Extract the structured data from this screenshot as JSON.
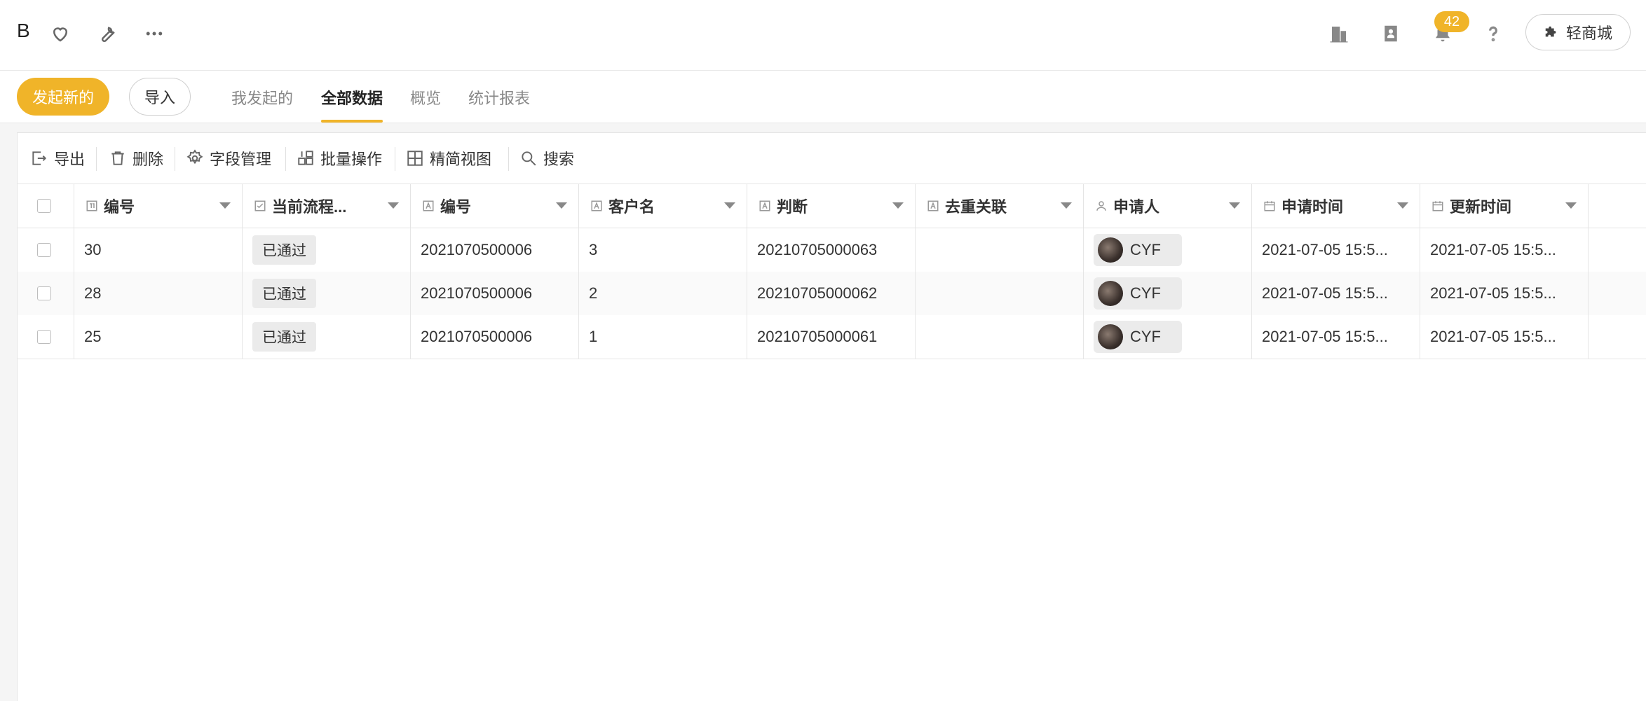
{
  "header": {
    "app_title": "B",
    "notification_count": "42",
    "mall_label": "轻商城",
    "icons": [
      "heart-icon",
      "wrench-icon",
      "more-icon",
      "building-icon",
      "contacts-icon",
      "bell-icon",
      "help-icon",
      "puzzle-icon"
    ]
  },
  "subheader": {
    "new_button": "发起新的",
    "import_button": "导入",
    "tabs": [
      {
        "label": "我发起的",
        "active": false
      },
      {
        "label": "全部数据",
        "active": true
      },
      {
        "label": "概览",
        "active": false
      },
      {
        "label": "统计报表",
        "active": false
      }
    ]
  },
  "toolbar": {
    "export": "导出",
    "delete": "删除",
    "field_manage": "字段管理",
    "batch": "批量操作",
    "simple_view": "精简视图",
    "search": "搜索"
  },
  "table": {
    "columns": [
      "编号",
      "当前流程...",
      "编号",
      "客户名",
      "判断",
      "去重关联",
      "申请人",
      "申请时间",
      "更新时间"
    ],
    "rows": [
      {
        "id": "30",
        "status": "已通过",
        "code": "2021070500006",
        "customer": "3",
        "judge": "20210705000063",
        "dedup": "",
        "applicant": "CYF",
        "apply_time": "2021-07-05 15:5...",
        "update_time": "2021-07-05 15:5..."
      },
      {
        "id": "28",
        "status": "已通过",
        "code": "2021070500006",
        "customer": "2",
        "judge": "20210705000062",
        "dedup": "",
        "applicant": "CYF",
        "apply_time": "2021-07-05 15:5...",
        "update_time": "2021-07-05 15:5..."
      },
      {
        "id": "25",
        "status": "已通过",
        "code": "2021070500006",
        "customer": "1",
        "judge": "20210705000061",
        "dedup": "",
        "applicant": "CYF",
        "apply_time": "2021-07-05 15:5...",
        "update_time": "2021-07-05 15:5..."
      }
    ]
  },
  "colors": {
    "accent": "#f0b429",
    "border": "#e4e4e4"
  }
}
